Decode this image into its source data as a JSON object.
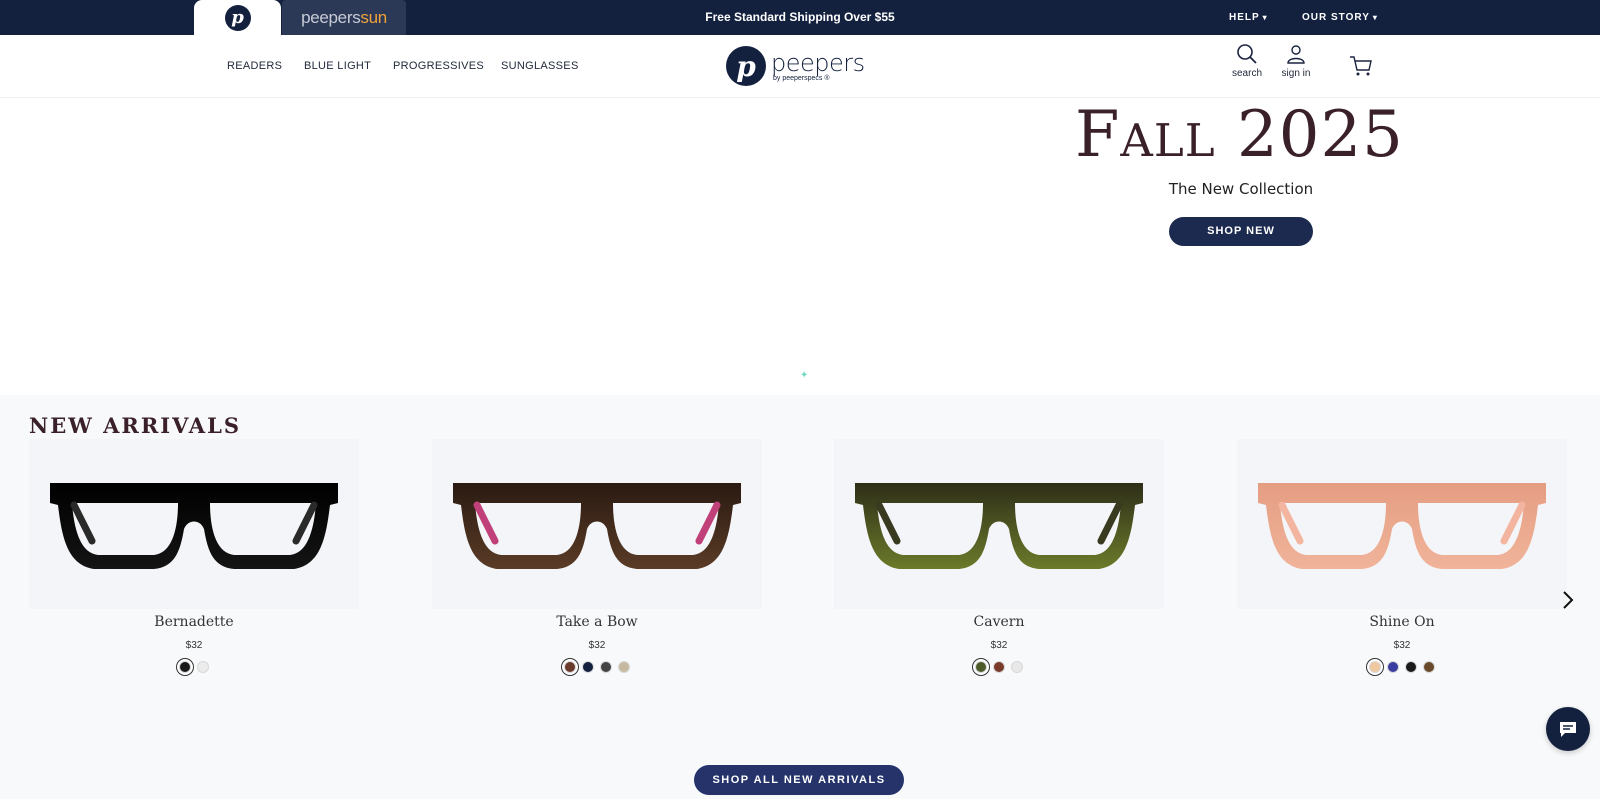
{
  "topbar": {
    "readers_brand": "p",
    "sun_brand_a": "peepers",
    "sun_brand_b": "sun",
    "announcement": "Free Standard Shipping Over $55",
    "help": "HELP",
    "our_story": "OUR STORY"
  },
  "header": {
    "nav": [
      "READERS",
      "BLUE LIGHT",
      "PROGRESSIVES",
      "SUNGLASSES"
    ],
    "logo_mark": "p",
    "logo_word": "peepers",
    "logo_sub": "by peeperspecs ®",
    "search_label": "search",
    "signin_label": "sign in"
  },
  "hero": {
    "title": "Fall 2025",
    "subtitle": "The New Collection",
    "button": "SHOP NEW"
  },
  "arrivals": {
    "title": "NEW ARRIVALS",
    "products": [
      {
        "name": "Bernadette",
        "price": "$32",
        "swatches": [
          "#1a1a1a",
          "#ececec"
        ],
        "frame": "#141414",
        "frame2": "#000000",
        "arm": "#2a2a2a"
      },
      {
        "name": "Take a Bow",
        "price": "$32",
        "swatches": [
          "#6a3a2a",
          "#13213f",
          "#444444",
          "#c7b8a0"
        ],
        "frame": "#5a3b26",
        "frame2": "#2a1a12",
        "arm": "#c0407a"
      },
      {
        "name": "Cavern",
        "price": "$32",
        "swatches": [
          "#4d5a2a",
          "#7a3a2a",
          "#e8e8e8"
        ],
        "frame": "#6b7a2a",
        "frame2": "#2e2e18",
        "arm": "#3a3a20"
      },
      {
        "name": "Shine On",
        "price": "$32",
        "swatches": [
          "#f0c8a0",
          "#3a3ea0",
          "#1a1a1a",
          "#6a4a2a"
        ],
        "frame": "#f0b49a",
        "frame2": "#e59d82",
        "arm": "#f3b5a0"
      }
    ],
    "shop_all": "SHOP ALL NEW ARRIVALS"
  }
}
